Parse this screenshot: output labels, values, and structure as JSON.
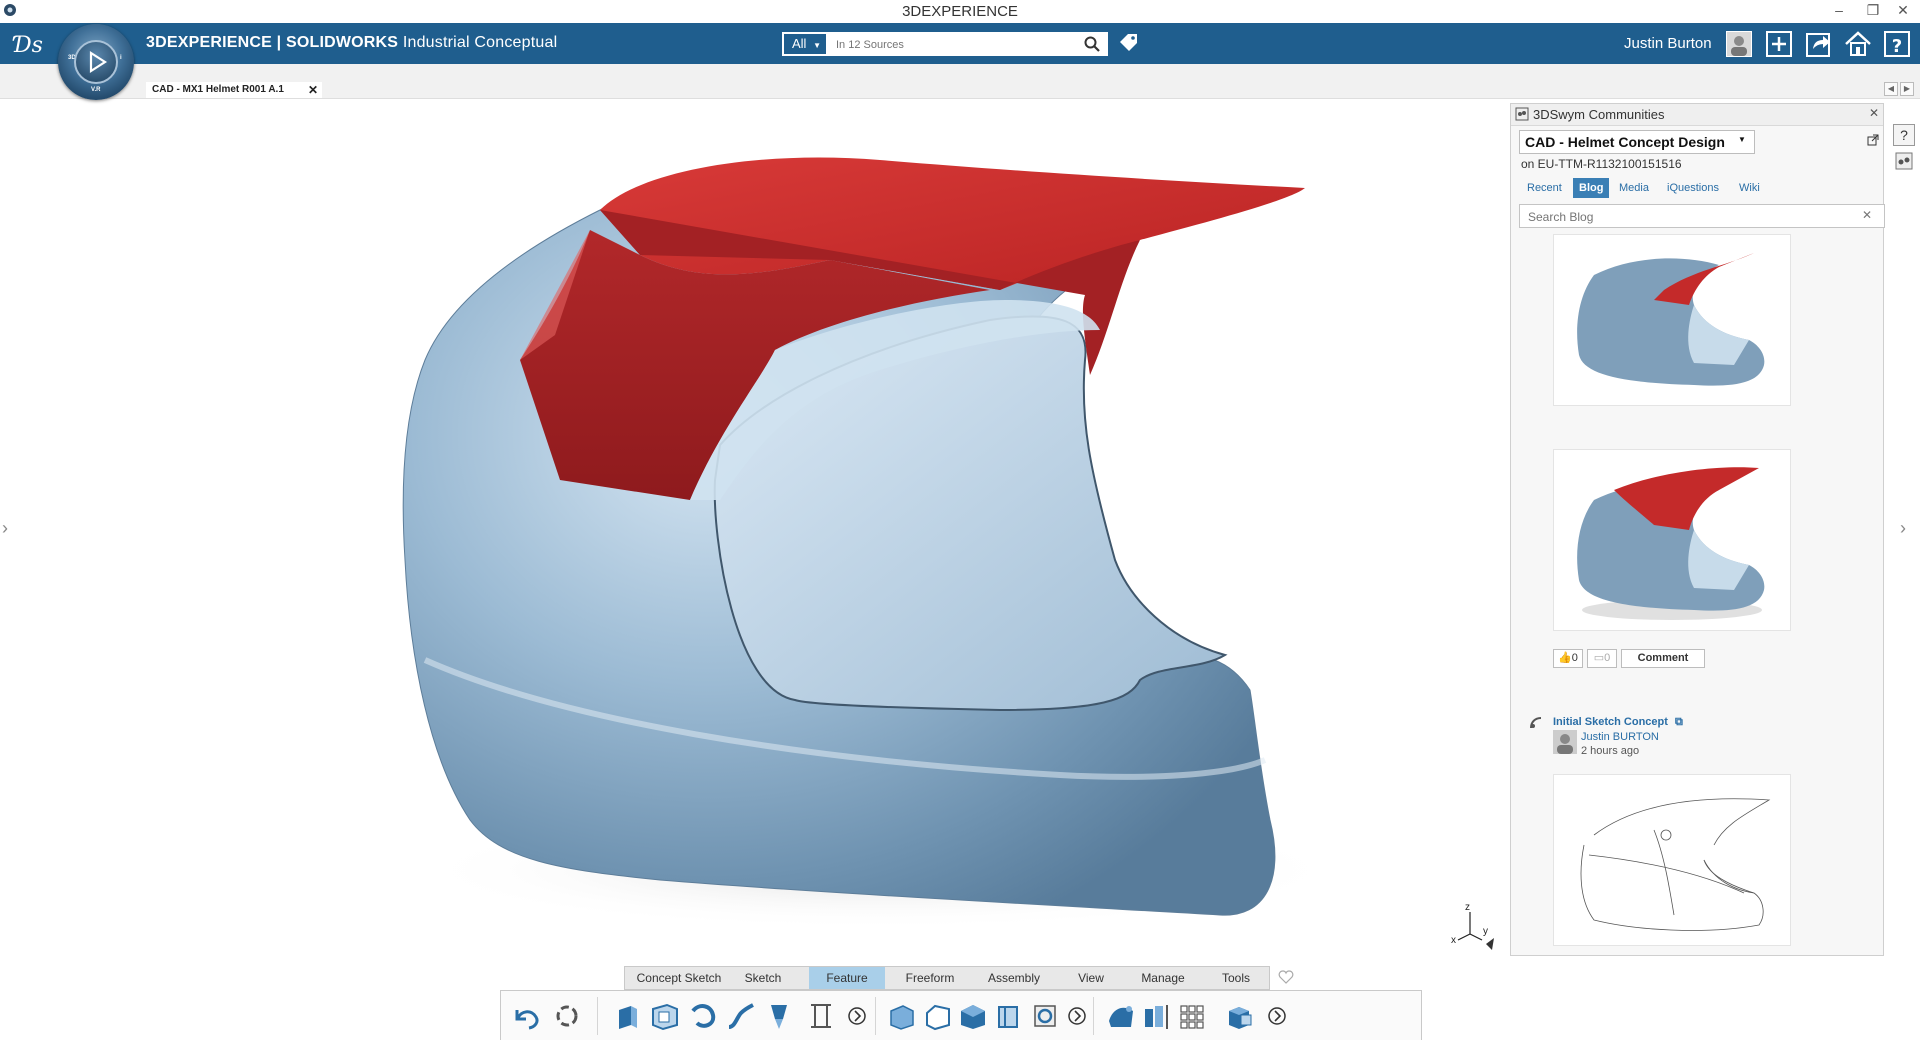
{
  "window": {
    "title": "3DEXPERIENCE"
  },
  "appbar": {
    "brand_bold": "3DEXPERIENCE | SOLIDWORKS",
    "brand_rest": " Industrial Conceptual",
    "search": {
      "scope": "All",
      "placeholder": "In 12 Sources"
    },
    "user_name": "Justin Burton"
  },
  "compass": {
    "label_3d": "3D",
    "label_vr": "V.R",
    "label_i": "i"
  },
  "tabs": {
    "document": "CAD - MX1 Helmet R001 A.1"
  },
  "panel": {
    "title": "3DSwym Communities",
    "community": "CAD - Helmet Concept Design",
    "server": "on EU-TTM-R1132100151516",
    "tabs": [
      "Recent",
      "Blog",
      "Media",
      "iQuestions",
      "Wiki"
    ],
    "active_tab": "Blog",
    "search_placeholder": "Search Blog",
    "likes": "0",
    "comments_count": "0",
    "comment_label": "Comment",
    "post": {
      "title": "Initial Sketch Concept",
      "author": "Justin BURTON",
      "time": "2 hours ago"
    }
  },
  "axis_triad": {
    "z": "z",
    "x": "x",
    "y": "y"
  },
  "action_bar": {
    "sections": [
      "Concept Sketch",
      "Sketch",
      "Feature",
      "Freeform",
      "Assembly",
      "View",
      "Manage",
      "Tools"
    ],
    "active_section": "Feature"
  },
  "icons": [
    "ds-logo-icon",
    "compass-icon",
    "search-icon",
    "tag-icon",
    "avatar",
    "add-icon",
    "share-icon",
    "home-icon",
    "help-icon",
    "undo-icon",
    "rebuild-icon"
  ],
  "colors": {
    "appbar": "#1f5e8e",
    "helmet_shell": "#8fb3cf",
    "helmet_visor": "#c42a2a",
    "active_section": "#a9cfe9"
  }
}
